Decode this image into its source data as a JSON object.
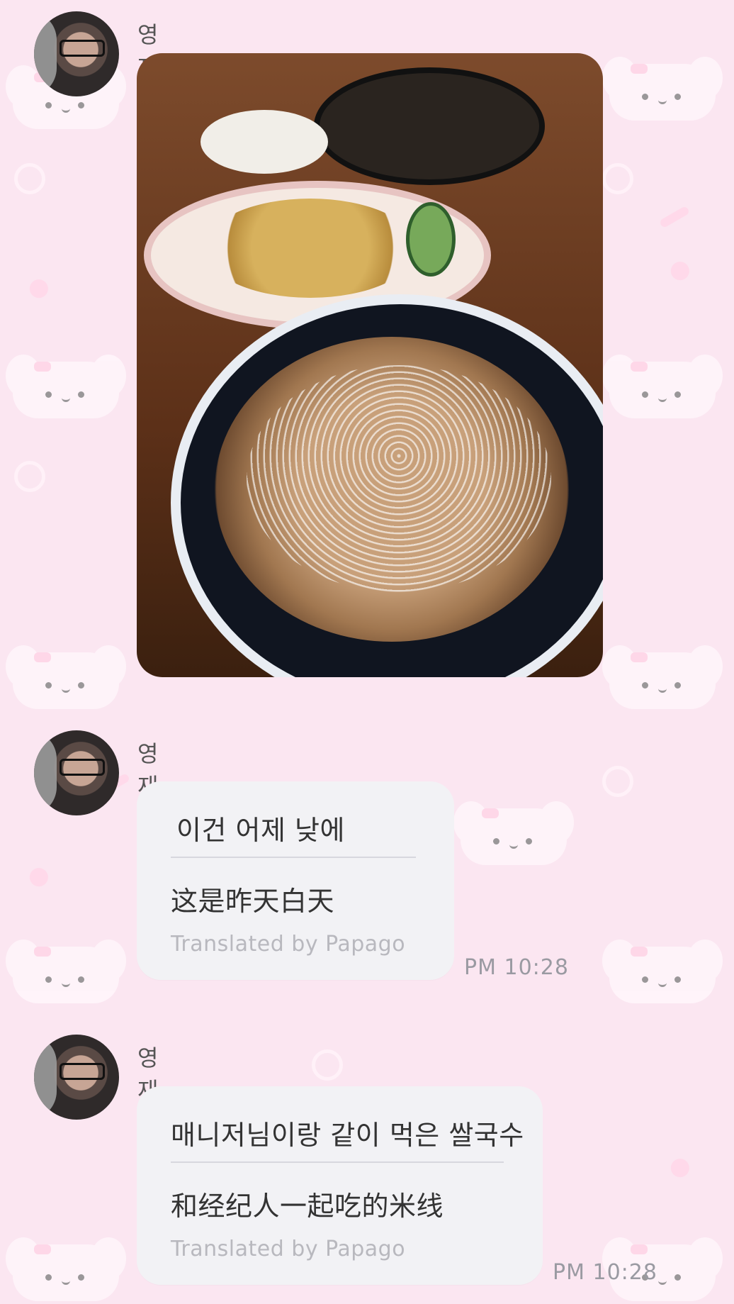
{
  "messages": [
    {
      "sender": "영재",
      "sender_emoji": "💛",
      "type": "image",
      "image_description_icon": "photo-noodles"
    },
    {
      "sender": "영재",
      "sender_emoji": "💛",
      "type": "text",
      "text": "이건 어제 낮에",
      "translation": "这是昨天白天",
      "translated_by": "Translated by Papago",
      "time": "PM 10:28"
    },
    {
      "sender": "영재",
      "sender_emoji": "💛",
      "type": "text",
      "text": "매니저님이랑 같이 먹은 쌀국수",
      "translation": "和经纪人一起吃的米线",
      "translated_by": "Translated by Papago",
      "time": "PM 10:28"
    }
  ],
  "colors": {
    "background": "#fbe6f1",
    "bubble": "#f2f2f5",
    "text": "#333333",
    "muted": "#b8b8be",
    "time": "#9a9aa2",
    "heart": "#f5c21b"
  }
}
